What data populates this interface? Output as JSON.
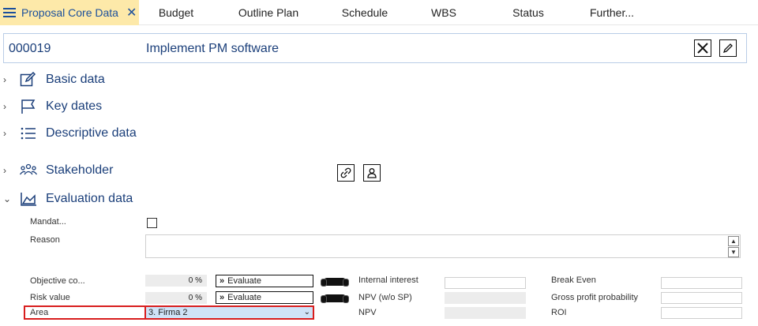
{
  "tabs": [
    {
      "label": "Proposal Core Data",
      "active": true
    },
    {
      "label": "Budget"
    },
    {
      "label": "Outline Plan"
    },
    {
      "label": "Schedule"
    },
    {
      "label": "WBS"
    },
    {
      "label": "Status"
    },
    {
      "label": "Further..."
    }
  ],
  "record": {
    "id": "000019",
    "title": "Implement PM software"
  },
  "sections": {
    "basic": "Basic data",
    "keydates": "Key dates",
    "descriptive": "Descriptive data",
    "stakeholder": "Stakeholder",
    "evaluation": "Evaluation data"
  },
  "form": {
    "mandatory_label": "Mandat...",
    "reason_label": "Reason",
    "objective_label": "Objective co...",
    "objective_value": "0 %",
    "risk_label": "Risk value",
    "risk_value": "0 %",
    "evaluate_label": "Evaluate",
    "area_label": "Area",
    "area_value": "3. Firma 2",
    "internal_interest_label": "Internal interest",
    "npv_wo_sp_label": "NPV (w/o SP)",
    "npv_label": "NPV",
    "break_even_label": "Break Even",
    "gross_profit_label": "Gross profit probability",
    "roi_label": "ROI"
  },
  "colors": {
    "accent": "#1b4f9c",
    "active_tab": "#fde9a9",
    "highlight": "#d81e1e"
  }
}
